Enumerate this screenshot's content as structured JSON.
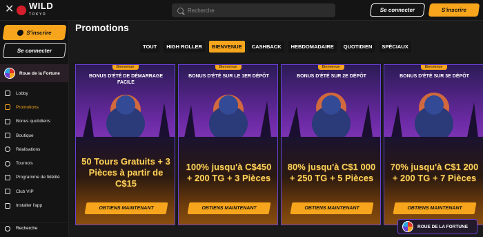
{
  "topbar": {
    "logo_text": "WILD",
    "logo_sub": "TOKYO",
    "search_placeholder": "Recherche",
    "login_label": "Se connecter",
    "signup_label": "S'inscrire"
  },
  "sidebar": {
    "signup_label": "S'inscrire",
    "login_label": "Se connecter",
    "wheel_label": "Roue de la Fortune",
    "items": [
      {
        "label": "Lobby",
        "icon": "home-icon"
      },
      {
        "label": "Promotions",
        "icon": "gift-icon",
        "active": true
      },
      {
        "label": "Bonus quotidiens",
        "icon": "calendar-icon"
      },
      {
        "label": "Boutique",
        "icon": "bag-icon"
      },
      {
        "label": "Réalisations",
        "icon": "trophy-icon"
      },
      {
        "label": "Tournois",
        "icon": "tournament-icon"
      },
      {
        "label": "Programme de fidélité",
        "icon": "crown-icon"
      },
      {
        "label": "Club VIP",
        "icon": "diamond-icon"
      },
      {
        "label": "Installer l'app",
        "icon": "download-icon"
      }
    ],
    "search_label": "Recherche"
  },
  "main": {
    "title": "Promotions",
    "tabs": [
      {
        "label": "TOUT"
      },
      {
        "label": "HIGH ROLLER"
      },
      {
        "label": "BIENVENUE",
        "active": true
      },
      {
        "label": "CASHBACK"
      },
      {
        "label": "HEBDOMADAIRE"
      },
      {
        "label": "QUOTIDIEN"
      },
      {
        "label": "SPÉCIAUX"
      }
    ],
    "cards": [
      {
        "badge": "Bienvenue",
        "title": "BONUS D'ÉTÉ DE DÉMARRAGE FACILE",
        "body": "50 Tours Gratuits + 3 Pièces à partir de C$15",
        "cta": "OBTIENS MAINTENANT"
      },
      {
        "badge": "Bienvenue",
        "title": "BONUS D'ÉTÉ SUR LE 1ER DÉPÔT",
        "body": "100% jusqu'à C$450 + 200 TG + 3 Pièces",
        "cta": "OBTIENS MAINTENANT"
      },
      {
        "badge": "Bienvenue",
        "title": "BONUS D'ÉTÉ SUR 2E DÉPÔT",
        "body": "80% jusqu'à C$1 000 + 250 TG + 5 Pièces",
        "cta": "OBTIENS MAINTENANT"
      },
      {
        "badge": "Bienvenue",
        "title": "BONUS D'ÉTÉ SUR 3E DÉPÔT",
        "body": "70% jusqu'à C$1 200 + 200 TG + 7 Pièces",
        "cta": "OBTIENS MAINTENANT"
      }
    ]
  },
  "floating": {
    "wheel_label": "ROUE DE LA FORTUNE"
  },
  "colors": {
    "accent": "#f6a51c",
    "card_border": "#6a3fd8",
    "background": "#1a1a1a"
  }
}
